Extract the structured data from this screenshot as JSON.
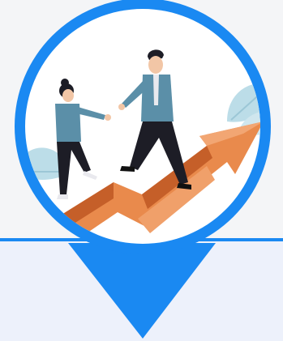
{
  "colors": {
    "accent": "#1a89f2",
    "background": "#f4f5f7",
    "lower_panel": "#edf1fb",
    "arrow": "#e98a4c",
    "arrow_dark": "#c55f29",
    "suit": "#5b8fa8",
    "leaf": "#bcdde8"
  },
  "illustration": {
    "subject": "teamwork-helping-hand",
    "figures": [
      "businessman",
      "businesswoman"
    ],
    "elements": [
      "upward-arrow",
      "leaves"
    ]
  }
}
